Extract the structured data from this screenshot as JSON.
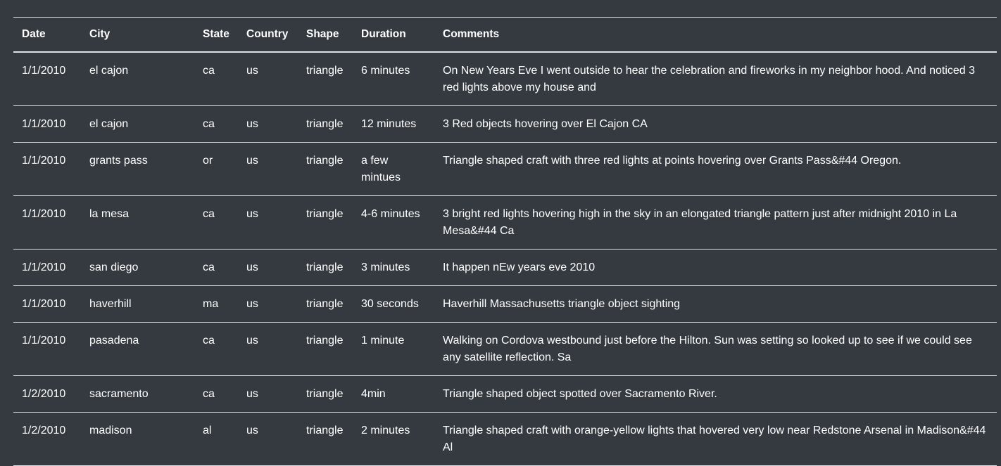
{
  "table": {
    "headers": [
      "Date",
      "City",
      "State",
      "Country",
      "Shape",
      "Duration",
      "Comments"
    ],
    "rows": [
      [
        "1/1/2010",
        "el cajon",
        "ca",
        "us",
        "triangle",
        "6 minutes",
        "On New Years Eve I went outside to hear the celebration and fireworks in my neighbor hood. And noticed 3 red lights above my house and"
      ],
      [
        "1/1/2010",
        "el cajon",
        "ca",
        "us",
        "triangle",
        "12 minutes",
        "3 Red objects hovering over El Cajon CA"
      ],
      [
        "1/1/2010",
        "grants pass",
        "or",
        "us",
        "triangle",
        "a few mintues",
        "Triangle shaped craft with three red lights at points hovering over Grants Pass&#44 Oregon."
      ],
      [
        "1/1/2010",
        "la mesa",
        "ca",
        "us",
        "triangle",
        "4-6 minutes",
        "3 bright red lights hovering high in the sky in an elongated triangle pattern just after midnight 2010 in La Mesa&#44 Ca"
      ],
      [
        "1/1/2010",
        "san diego",
        "ca",
        "us",
        "triangle",
        "3 minutes",
        "It happen nEw years eve 2010"
      ],
      [
        "1/1/2010",
        "haverhill",
        "ma",
        "us",
        "triangle",
        "30 seconds",
        "Haverhill Massachusetts triangle object sighting"
      ],
      [
        "1/1/2010",
        "pasadena",
        "ca",
        "us",
        "triangle",
        "1 minute",
        "Walking on Cordova westbound just before the Hilton. Sun was setting so looked up to see if we could see any satellite reflection. Sa"
      ],
      [
        "1/2/2010",
        "sacramento",
        "ca",
        "us",
        "triangle",
        "4min",
        "Triangle shaped object spotted over Sacramento River."
      ],
      [
        "1/2/2010",
        "madison",
        "al",
        "us",
        "triangle",
        "2 minutes",
        "Triangle shaped craft with orange-yellow lights that hovered very low near Redstone Arsenal in Madison&#44 Al"
      ]
    ]
  }
}
